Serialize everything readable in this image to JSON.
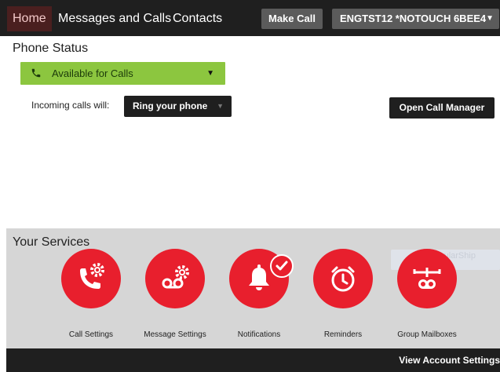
{
  "nav": {
    "home": "Home",
    "messages_calls": "Messages and Calls",
    "contacts": "Contacts",
    "make_call": "Make Call",
    "account": "ENGTST12 *NOTOUCH 6BEE4"
  },
  "phone_status": {
    "title": "Phone Status",
    "availability": "Available for Calls",
    "incoming_label": "Incoming calls will:",
    "incoming_value": "Ring your phone",
    "open_call_manager": "Open Call Manager"
  },
  "services": {
    "title": "Your Services",
    "ghost_text": "PopularShip",
    "items": [
      {
        "label": "Call Settings",
        "icon": "call-settings-icon"
      },
      {
        "label": "Message Settings",
        "icon": "voicemail-settings-icon"
      },
      {
        "label": "Notifications",
        "icon": "bell-icon",
        "badge": "check"
      },
      {
        "label": "Reminders",
        "icon": "alarm-clock-icon"
      },
      {
        "label": "Group Mailboxes",
        "icon": "group-mailbox-icon"
      }
    ]
  },
  "footer": {
    "account_settings": "View Account Settings"
  },
  "colors": {
    "accent_red": "#e81f2d",
    "available_green": "#8cc63f",
    "dark": "#1f1f1f",
    "services_bg": "#d6d6d6"
  }
}
